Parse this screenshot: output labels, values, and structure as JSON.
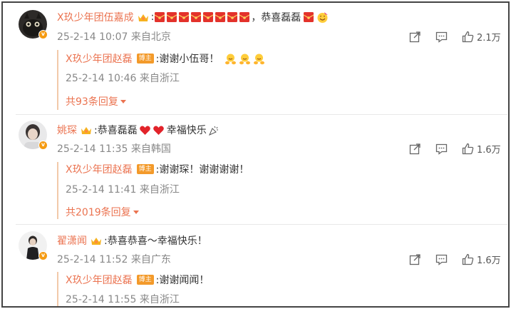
{
  "comments": [
    {
      "username": "X玖少年团伍嘉成",
      "text_prefix": ":",
      "red_envelopes": 8,
      "text_suffix": "，恭喜磊磊",
      "timestamp": "25-2-14 10:07 来自北京",
      "likes": "2.1万",
      "reply": {
        "username": "X玖少年团赵磊",
        "badge": "博主",
        "text": ":谢谢小伍哥！",
        "timestamp": "25-2-14 10:46 来自浙江",
        "more": "共93条回复"
      }
    },
    {
      "username": "姚琛",
      "text_a": ":恭喜磊磊",
      "text_b": "幸福快乐",
      "timestamp": "25-2-14 11:35 来自韩国",
      "likes": "1.6万",
      "reply": {
        "username": "X玖少年团赵磊",
        "badge": "博主",
        "text": ":谢谢琛！谢谢谢谢！",
        "timestamp": "25-2-14 11:41 来自浙江",
        "more": "共2019条回复"
      }
    },
    {
      "username": "翟潇闻",
      "text": ":恭喜恭喜～幸福快乐！",
      "timestamp": "25-2-14 11:52 来自广东",
      "likes": "1.6万",
      "reply": {
        "username": "X玖少年团赵磊",
        "badge": "博主",
        "text": ":谢谢闻闻！",
        "timestamp": "25-2-14 11:55 来自浙江"
      }
    }
  ],
  "colors": {
    "username": "#eb7350",
    "meta": "#888888",
    "host_badge": "#f39a2a",
    "reply_bar": "#f2c9a9"
  },
  "icons": [
    "share-icon",
    "comment-icon",
    "like-icon",
    "crown-badge-icon",
    "red-envelope-icon",
    "heart-icon",
    "clapping-emoji-icon",
    "party-emoji-icon"
  ]
}
